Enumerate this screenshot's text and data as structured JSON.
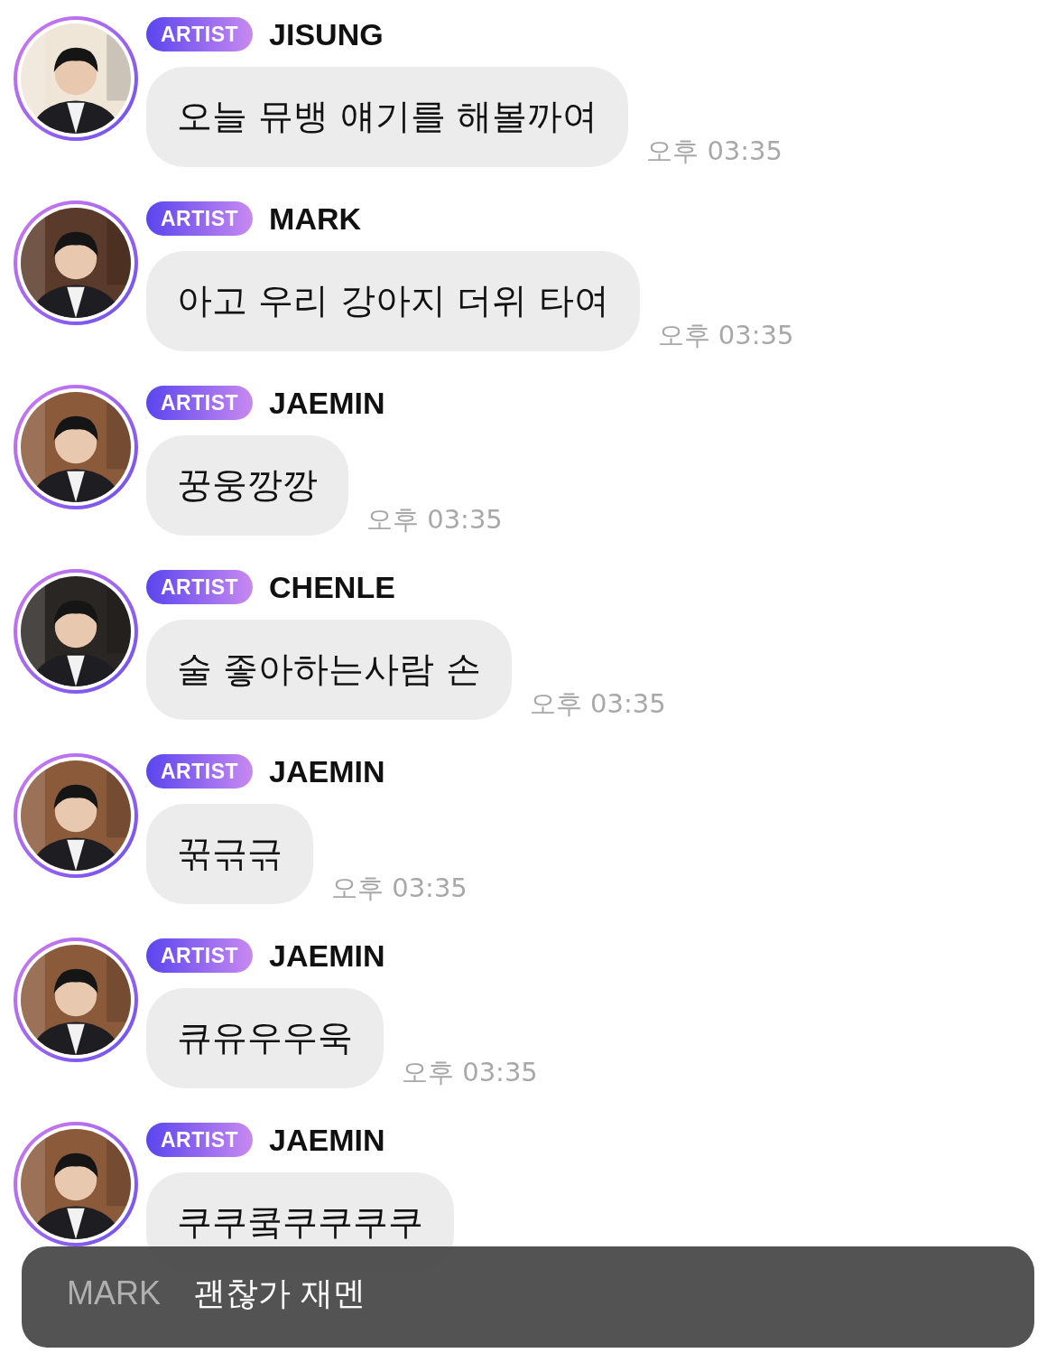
{
  "messages": [
    {
      "badge": "ARTIST",
      "name": "JISUNG",
      "text": "오늘 뮤뱅 얘기를 해볼까여",
      "time": "오후 03:35"
    },
    {
      "badge": "ARTIST",
      "name": "MARK",
      "text": "아고 우리 강아지 더위 타여",
      "time": "오후 03:35"
    },
    {
      "badge": "ARTIST",
      "name": "JAEMIN",
      "text": "꿍웅깡깡",
      "time": "오후 03:35"
    },
    {
      "badge": "ARTIST",
      "name": "CHENLE",
      "text": "술 좋아하는사람 손",
      "time": "오후 03:35"
    },
    {
      "badge": "ARTIST",
      "name": "JAEMIN",
      "text": "꾺귺귺",
      "time": "오후 03:35"
    },
    {
      "badge": "ARTIST",
      "name": "JAEMIN",
      "text": "큐유우우욱",
      "time": "오후 03:35"
    },
    {
      "badge": "ARTIST",
      "name": "JAEMIN",
      "text": "쿠쿠쿸쿠쿠쿠쿠"
    }
  ],
  "toast": {
    "sender": "MARK",
    "text": "괜찮가 재멘"
  }
}
